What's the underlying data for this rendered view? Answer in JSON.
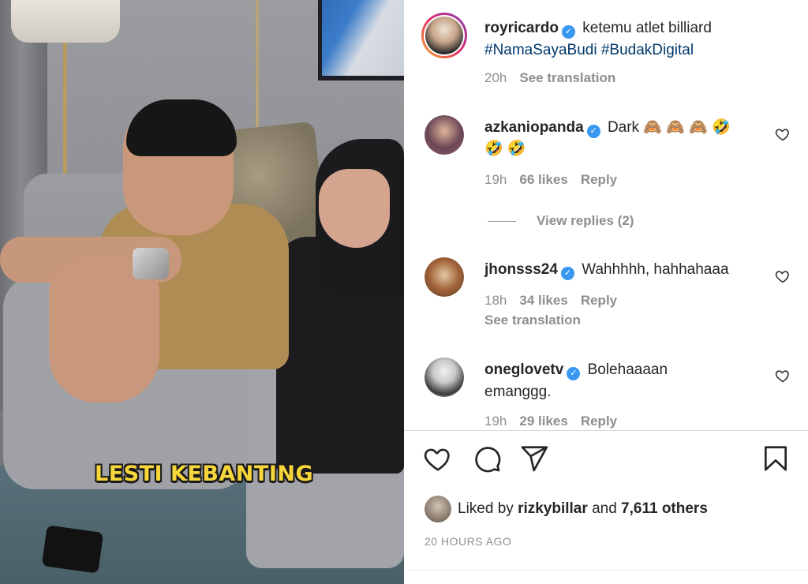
{
  "media": {
    "caption_overlay": "LESTI KEBANTING"
  },
  "post": {
    "author": "royricardo",
    "caption": "ketemu atlet billiard",
    "hashtags": "#NamaSayaBudi #BudakDigital",
    "time": "20h",
    "see_translation": "See translation"
  },
  "comments": [
    {
      "username": "azkaniopanda",
      "text_line1": "Dark 🙈 🙈 🙈 🤣",
      "text_line2": "🤣 🤣",
      "time": "19h",
      "likes": "66 likes",
      "reply": "Reply",
      "avatar_color": "#8a5a6e"
    },
    {
      "username": "jhonsss24",
      "text_line1": "Wahhhhh, hahhahaaa",
      "time": "18h",
      "likes": "34 likes",
      "reply": "Reply",
      "see_translation": "See translation",
      "avatar_color": "#a2643a"
    },
    {
      "username": "oneglovetv",
      "text_line1": "Bolehaaaan",
      "text_line2": "emanggg.",
      "time": "19h",
      "likes": "29 likes",
      "reply": "Reply",
      "avatar_color": "#c9c9c9"
    }
  ],
  "view_replies": "View replies (2)",
  "likes": {
    "prefix": "Liked by",
    "user": "rizkybillar",
    "conj": "and",
    "others": "7,611 others"
  },
  "timestamp": "20 HOURS AGO",
  "icons": [
    "verified-icon",
    "heart-icon",
    "comment-icon",
    "share-icon",
    "bookmark-icon"
  ],
  "colors": {
    "accent": "#3897f0",
    "hashtag": "#00376b",
    "muted": "#8e8e8e",
    "text": "#262626",
    "overlay_text": "#f6d63a"
  }
}
